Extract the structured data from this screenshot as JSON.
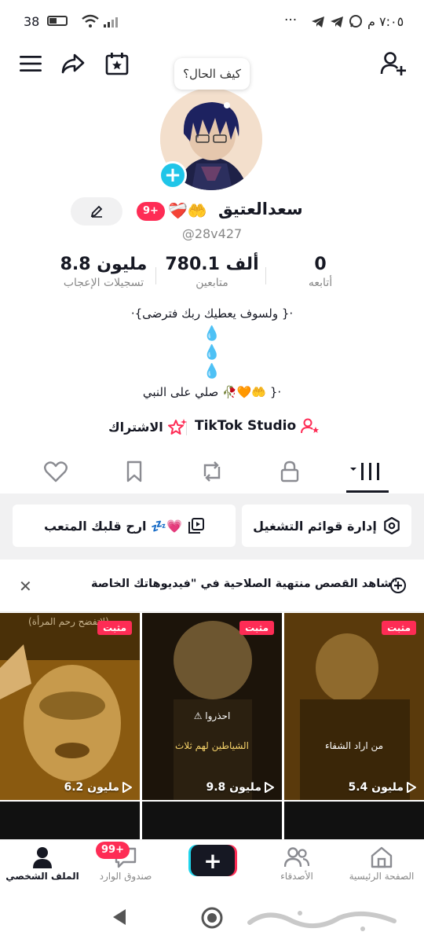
{
  "status_bar": {
    "time": "٧:٠٥ م",
    "battery": "38",
    "more": "···"
  },
  "bubble_text": "كيف الحال؟",
  "profile": {
    "name": "سعدالعتيق",
    "name_emoji": "❤️‍🩹🤲",
    "badge": "9+",
    "username": "@28v427"
  },
  "stats": {
    "following": {
      "value": "0",
      "label": "أتابعه"
    },
    "followers": {
      "value": "780.1 ألف",
      "label": "متابعين"
    },
    "likes": {
      "value": "8.8 مليون",
      "label": "تسجيلات الإعجاب"
    }
  },
  "bio": {
    "line1": "·{ولسوف يعطيك ربك فترضى }·",
    "drops": [
      "💧",
      "💧",
      "💧"
    ],
    "line2": "صلي على النبي 🥀🧡🤲 }·"
  },
  "links": {
    "studio": "TikTok Studio",
    "subscribe": "الاشتراك"
  },
  "actions": {
    "playlists": "إدارة قوائم التشغيل",
    "rest_heart": "ارح قلبك المتعب 💤💗"
  },
  "banner": {
    "text": "شاهد القصص منتهية الصلاحية في \"فيديوهاتك الخاصة\""
  },
  "videos": [
    {
      "tag": "مثبت",
      "views": "6.2 مليون",
      "caption": "(لاتفضح رحم المرأة)"
    },
    {
      "tag": "مثبت",
      "views": "9.8 مليون",
      "caption": "الشياطين لهم ثلاث",
      "warning": "احذروا"
    },
    {
      "tag": "مثبت",
      "views": "5.4 مليون",
      "caption": "من اراد الشفاء"
    }
  ],
  "bottom_nav": {
    "home": "الصفحة الرئيسية",
    "friends": "الأصدقاء",
    "inbox": "صندوق الوارد",
    "inbox_badge": "99+",
    "profile": "الملف الشخصي"
  },
  "colors": {
    "accent": "#fe2c55",
    "cyan": "#20c5e8",
    "text": "#161823"
  }
}
